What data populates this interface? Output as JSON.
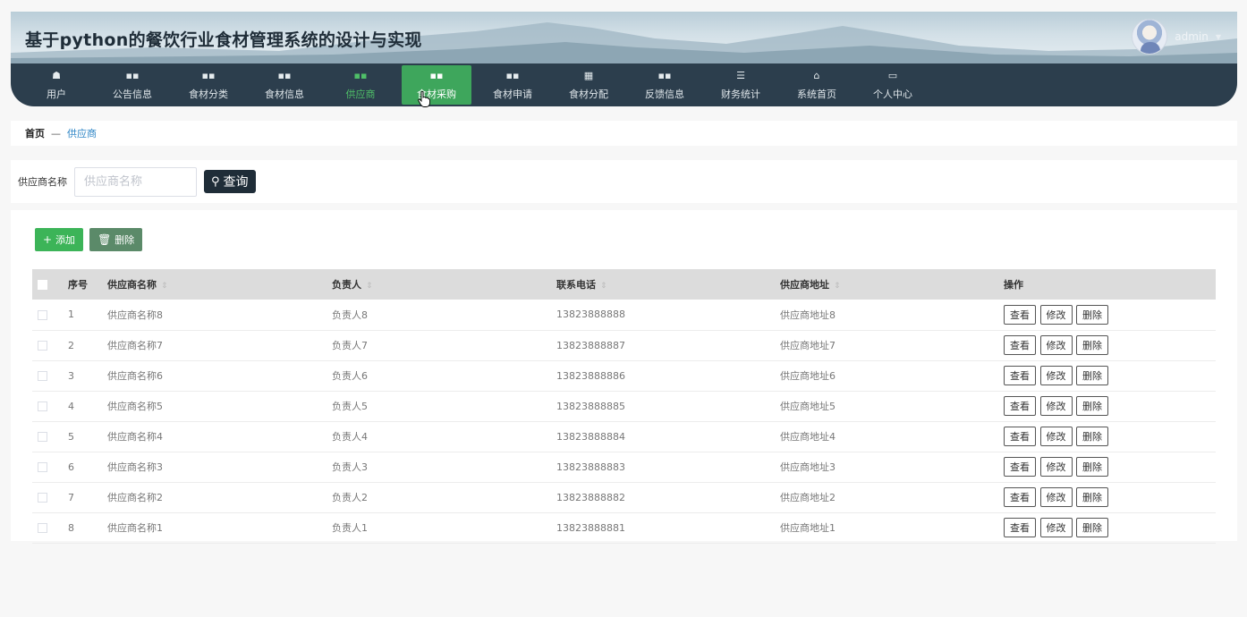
{
  "app": {
    "title": "基于python的餐饮行业食材管理系统的设计与实现",
    "username": "admin"
  },
  "nav": {
    "items": [
      {
        "label": "用户",
        "icon": "user-icon",
        "glyph": "☗",
        "state": "normal"
      },
      {
        "label": "公告信息",
        "icon": "grid-icon",
        "glyph": "▪▪",
        "state": "normal"
      },
      {
        "label": "食材分类",
        "icon": "grid-icon",
        "glyph": "▪▪",
        "state": "normal"
      },
      {
        "label": "食材信息",
        "icon": "grid-icon",
        "glyph": "▪▪",
        "state": "normal"
      },
      {
        "label": "供应商",
        "icon": "grid-icon",
        "glyph": "▪▪",
        "state": "active"
      },
      {
        "label": "食材采购",
        "icon": "grid-icon",
        "glyph": "▪▪",
        "state": "hover"
      },
      {
        "label": "食材申请",
        "icon": "grid-icon",
        "glyph": "▪▪",
        "state": "normal"
      },
      {
        "label": "食材分配",
        "icon": "table-icon",
        "glyph": "▦",
        "state": "normal"
      },
      {
        "label": "反馈信息",
        "icon": "grid-icon",
        "glyph": "▪▪",
        "state": "normal"
      },
      {
        "label": "财务统计",
        "icon": "sliders-icon",
        "glyph": "☰",
        "state": "normal"
      },
      {
        "label": "系统首页",
        "icon": "home-icon",
        "glyph": "⌂",
        "state": "normal"
      },
      {
        "label": "个人中心",
        "icon": "card-icon",
        "glyph": "▭",
        "state": "normal"
      }
    ]
  },
  "breadcrumb": {
    "home": "首页",
    "separator": "—",
    "current": "供应商"
  },
  "search": {
    "label": "供应商名称",
    "placeholder": "供应商名称",
    "value": "",
    "button_label": "查询"
  },
  "toolbar": {
    "add_label": "添加",
    "delete_label": "删除"
  },
  "table": {
    "headers": {
      "index": "序号",
      "name": "供应商名称",
      "person": "负责人",
      "phone": "联系电话",
      "address": "供应商地址",
      "actions": "操作"
    },
    "action_labels": {
      "view": "查看",
      "edit": "修改",
      "delete": "删除"
    },
    "rows": [
      {
        "index": "1",
        "name": "供应商名称8",
        "person": "负责人8",
        "phone": "13823888888",
        "address": "供应商地址8"
      },
      {
        "index": "2",
        "name": "供应商名称7",
        "person": "负责人7",
        "phone": "13823888887",
        "address": "供应商地址7"
      },
      {
        "index": "3",
        "name": "供应商名称6",
        "person": "负责人6",
        "phone": "13823888886",
        "address": "供应商地址6"
      },
      {
        "index": "4",
        "name": "供应商名称5",
        "person": "负责人5",
        "phone": "13823888885",
        "address": "供应商地址5"
      },
      {
        "index": "5",
        "name": "供应商名称4",
        "person": "负责人4",
        "phone": "13823888884",
        "address": "供应商地址4"
      },
      {
        "index": "6",
        "name": "供应商名称3",
        "person": "负责人3",
        "phone": "13823888883",
        "address": "供应商地址3"
      },
      {
        "index": "7",
        "name": "供应商名称2",
        "person": "负责人2",
        "phone": "13823888882",
        "address": "供应商地址2"
      },
      {
        "index": "8",
        "name": "供应商名称1",
        "person": "负责人1",
        "phone": "13823888881",
        "address": "供应商地址1"
      }
    ]
  },
  "colors": {
    "nav_bg": "#2c3e4d",
    "accent_green": "#3ea65c",
    "search_button": "#1f2d38",
    "link_blue": "#2f86c6"
  }
}
